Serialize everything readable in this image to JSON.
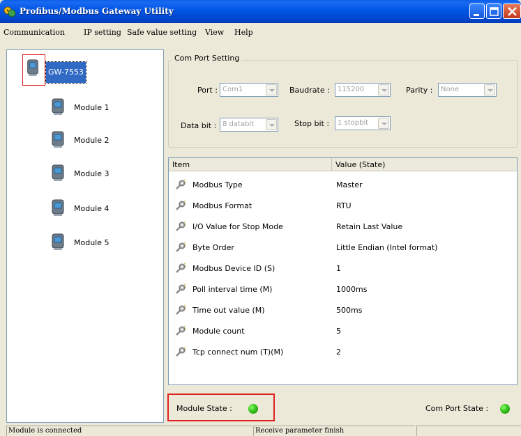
{
  "window": {
    "title": "Profibus/Modbus Gateway Utility",
    "icon": "gateway-app-icon",
    "controls": [
      "minimize-icon",
      "maximize-icon",
      "close-icon"
    ]
  },
  "menu": [
    "Communication",
    "IP setting",
    "Safe value setting",
    "View",
    "Help"
  ],
  "tree": {
    "root": "GW-7553",
    "modules": [
      "Module 1",
      "Module 2",
      "Module 3",
      "Module 4",
      "Module 5"
    ]
  },
  "com_port_setting": {
    "title": "Com Port Setting",
    "port_label": "Port :",
    "port_value": "Com1",
    "baudrate_label": "Baudrate :",
    "baudrate_value": "115200",
    "parity_label": "Parity :",
    "parity_value": "None",
    "databit_label": "Data bit :",
    "databit_value": "8 databit",
    "stopbit_label": "Stop bit :",
    "stopbit_value": "1 stopbit"
  },
  "list": {
    "headers": [
      "Item",
      "Value (State)"
    ],
    "rows": [
      {
        "item": "Modbus Type",
        "value": "Master"
      },
      {
        "item": "Modbus Format",
        "value": "RTU"
      },
      {
        "item": "I/O Value for Stop Mode",
        "value": "Retain Last Value"
      },
      {
        "item": "Byte Order",
        "value": "Little Endian (Intel format)"
      },
      {
        "item": "Modbus Device ID (S)",
        "value": "1"
      },
      {
        "item": "Poll interval time (M)",
        "value": "1000ms"
      },
      {
        "item": "Time out value (M)",
        "value": "500ms"
      },
      {
        "item": "Module count",
        "value": "5"
      },
      {
        "item": "Tcp connect num (T)(M)",
        "value": "2"
      }
    ]
  },
  "states": {
    "module_state_label": "Module  State :",
    "module_state_color": "#33c21b",
    "com_port_state_label": "Com Port State :",
    "com_port_state_color": "#33c21b"
  },
  "statusbar": [
    "Module is connected",
    "Receive parameter finish",
    ""
  ]
}
